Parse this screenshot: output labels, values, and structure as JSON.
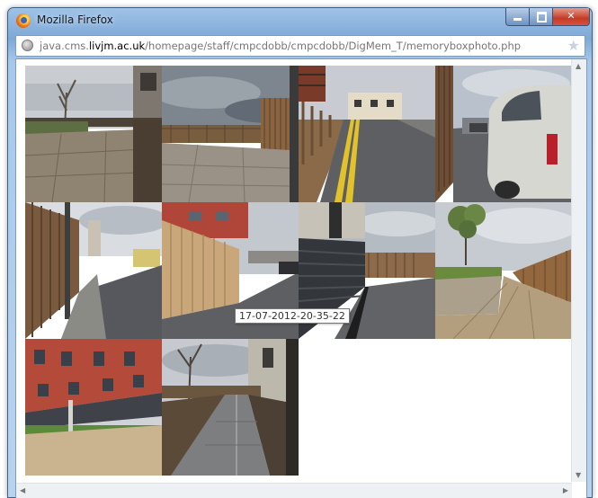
{
  "window": {
    "title": "Mozilla Firefox"
  },
  "address_bar": {
    "url_prefix": "java.cms.",
    "url_domain": "livjm.ac.uk",
    "url_path": "/homepage/staff/cmpcdobb/cmpcdobb/DigMem_T/memoryboxphoto.php"
  },
  "gallery": {
    "photo_count": 10,
    "columns": 4
  },
  "tooltip": {
    "text": "17-07-2012-20-35-22"
  },
  "icons": {
    "app": "firefox-icon",
    "minimize": "minimize-icon",
    "maximize": "maximize-icon",
    "close": "close-icon",
    "site": "globe-icon",
    "bookmark": "star-icon"
  }
}
